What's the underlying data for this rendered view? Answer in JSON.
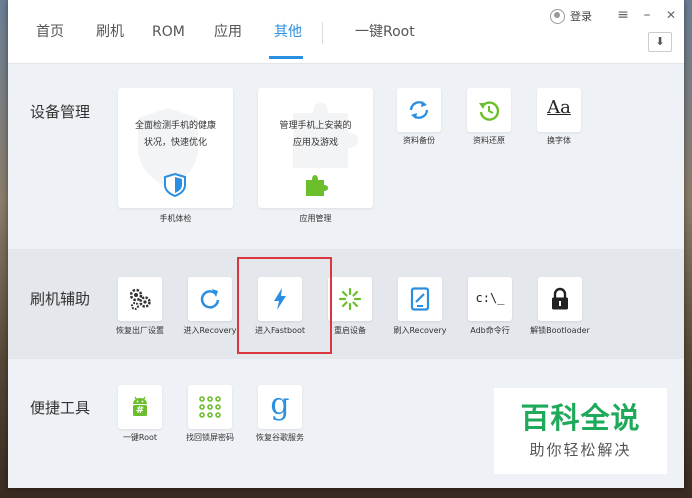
{
  "nav": {
    "tabs": [
      "首页",
      "刷机",
      "ROM",
      "应用",
      "其他"
    ],
    "active_tab": "其他",
    "one_click_root": "一键Root",
    "login": "登录",
    "menu_icon": "≡",
    "minimize_icon": "–",
    "close_icon": "✕",
    "download_icon": "⬇"
  },
  "sections": {
    "device": {
      "title": "设备管理",
      "cards": [
        {
          "desc_line1": "全面检测手机的健康",
          "desc_line2": "状况，快速优化",
          "label": "手机体检",
          "icon": "shield-icon"
        },
        {
          "desc_line1": "管理手机上安装的",
          "desc_line2": "应用及游戏",
          "label": "应用管理",
          "icon": "puzzle-icon"
        }
      ],
      "tiles": [
        {
          "label": "资料备份",
          "icon": "sync-icon"
        },
        {
          "label": "资料还原",
          "icon": "restore-icon"
        },
        {
          "label": "换字体",
          "icon": "font-icon",
          "glyph": "Aa"
        }
      ]
    },
    "flash": {
      "title": "刷机辅助",
      "tiles": [
        {
          "label": "恢复出厂设置",
          "icon": "gears-icon"
        },
        {
          "label": "进入Recovery",
          "icon": "refresh-icon"
        },
        {
          "label": "进入Fastboot",
          "icon": "lightning-icon"
        },
        {
          "label": "重启设备",
          "icon": "loading-icon"
        },
        {
          "label": "刷入Recovery",
          "icon": "tablet-icon"
        },
        {
          "label": "Adb命令行",
          "icon": "terminal-icon",
          "glyph": "c:\\_"
        },
        {
          "label": "解锁Bootloader",
          "icon": "lock-icon"
        }
      ]
    },
    "tools": {
      "title": "便捷工具",
      "tiles": [
        {
          "label": "一键Root",
          "icon": "android-icon",
          "glyph": "#"
        },
        {
          "label": "找回锁屏密码",
          "icon": "pattern-lock-icon"
        },
        {
          "label": "恢复谷歌服务",
          "icon": "google-icon",
          "glyph": "g"
        }
      ]
    }
  },
  "watermark": {
    "title": "百科全说",
    "subtitle": "助你轻松解决"
  },
  "colors": {
    "accent": "#2a8fe0",
    "green": "#6cbf2c",
    "highlight": "#d9363e",
    "watermark_green": "#1fa95b"
  }
}
